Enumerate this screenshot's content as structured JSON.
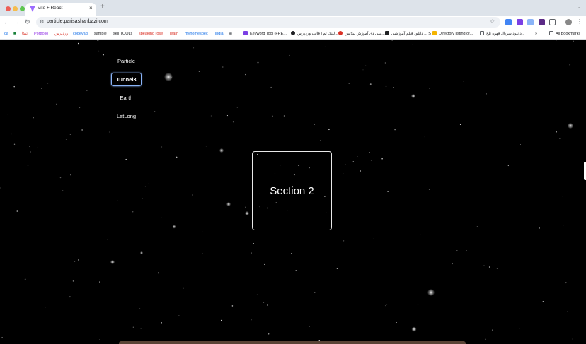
{
  "browser": {
    "tab_title": "Vite + React",
    "new_tab": "+",
    "tab_close": "×",
    "tab_menu": "⌄",
    "url": "particle.parisashahbazi.com",
    "back": "←",
    "forward": "→",
    "reload": "↻",
    "bookmark_star": "☆",
    "more_menu": "⋮",
    "bookmarks": [
      {
        "label": "ca",
        "color": "#1a73e8"
      },
      {
        "label": "■",
        "color": "#188038"
      },
      {
        "label": "تیکا",
        "color": "#d93025"
      },
      {
        "label": "Portfolio",
        "color": "#9334e6"
      },
      {
        "label": "وردپرس",
        "color": "#d93025"
      },
      {
        "label": "codeyad",
        "color": "#1a73e8"
      },
      {
        "label": "sample",
        "color": "#202124"
      },
      {
        "label": "sell TOOLs",
        "color": "#202124"
      },
      {
        "label": "speaking rose",
        "color": "#d93025"
      },
      {
        "label": "learn",
        "color": "#d93025"
      },
      {
        "label": "myhomespec",
        "color": "#1a73e8"
      },
      {
        "label": "india",
        "color": "#1a73e8"
      },
      {
        "label": "Keyword Tool (FRE...",
        "color": "#202124"
      },
      {
        "label": "لینک تم | قالب وردپرس...",
        "color": "#202124"
      },
      {
        "label": "سی دی آموزش پیلاتس...",
        "color": "#202124"
      },
      {
        "label": "دانلود فیلم آموزشی ... S",
        "color": "#202124"
      },
      {
        "label": "Directory listing of...",
        "color": "#202124"
      },
      {
        "label": "دانلود سریال قهوه تلخ...",
        "color": "#202124"
      },
      {
        "label": "»",
        "color": "#202124"
      },
      {
        "label": "All Bookmarks",
        "color": "#202124"
      }
    ]
  },
  "nav": {
    "items": [
      {
        "label": "Particle",
        "active": false
      },
      {
        "label": "Tunnel3",
        "active": true
      },
      {
        "label": "Earth",
        "active": false
      },
      {
        "label": "LatLong",
        "active": false
      }
    ]
  },
  "section": {
    "title": "Section 2"
  },
  "colors": {
    "background": "#000000",
    "text": "#ffffff",
    "active_border": "#8ab4f8",
    "chrome_tabbar": "#dde3ea"
  }
}
